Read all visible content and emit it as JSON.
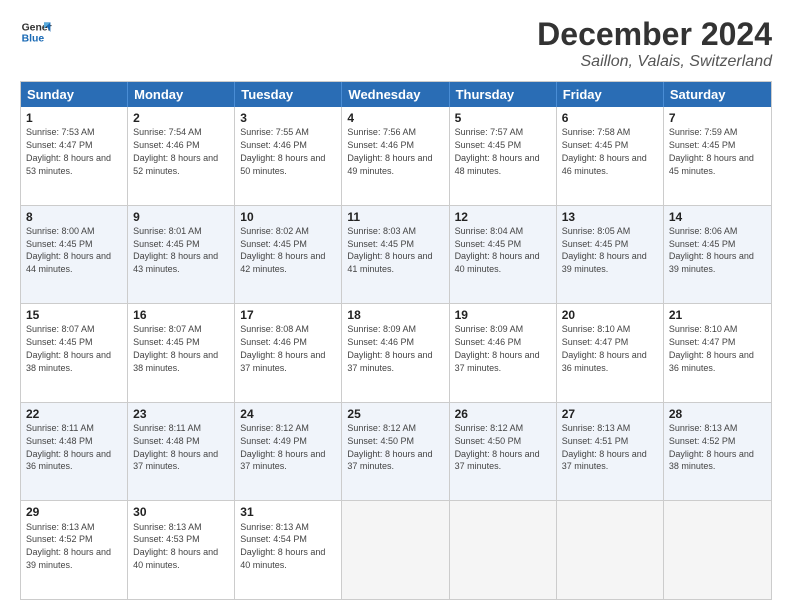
{
  "logo": {
    "line1": "General",
    "line2": "Blue"
  },
  "title": "December 2024",
  "subtitle": "Saillon, Valais, Switzerland",
  "headers": [
    "Sunday",
    "Monday",
    "Tuesday",
    "Wednesday",
    "Thursday",
    "Friday",
    "Saturday"
  ],
  "weeks": [
    [
      {
        "day": "1",
        "rise": "Sunrise: 7:53 AM",
        "set": "Sunset: 4:47 PM",
        "daylight": "Daylight: 8 hours and 53 minutes."
      },
      {
        "day": "2",
        "rise": "Sunrise: 7:54 AM",
        "set": "Sunset: 4:46 PM",
        "daylight": "Daylight: 8 hours and 52 minutes."
      },
      {
        "day": "3",
        "rise": "Sunrise: 7:55 AM",
        "set": "Sunset: 4:46 PM",
        "daylight": "Daylight: 8 hours and 50 minutes."
      },
      {
        "day": "4",
        "rise": "Sunrise: 7:56 AM",
        "set": "Sunset: 4:46 PM",
        "daylight": "Daylight: 8 hours and 49 minutes."
      },
      {
        "day": "5",
        "rise": "Sunrise: 7:57 AM",
        "set": "Sunset: 4:45 PM",
        "daylight": "Daylight: 8 hours and 48 minutes."
      },
      {
        "day": "6",
        "rise": "Sunrise: 7:58 AM",
        "set": "Sunset: 4:45 PM",
        "daylight": "Daylight: 8 hours and 46 minutes."
      },
      {
        "day": "7",
        "rise": "Sunrise: 7:59 AM",
        "set": "Sunset: 4:45 PM",
        "daylight": "Daylight: 8 hours and 45 minutes."
      }
    ],
    [
      {
        "day": "8",
        "rise": "Sunrise: 8:00 AM",
        "set": "Sunset: 4:45 PM",
        "daylight": "Daylight: 8 hours and 44 minutes."
      },
      {
        "day": "9",
        "rise": "Sunrise: 8:01 AM",
        "set": "Sunset: 4:45 PM",
        "daylight": "Daylight: 8 hours and 43 minutes."
      },
      {
        "day": "10",
        "rise": "Sunrise: 8:02 AM",
        "set": "Sunset: 4:45 PM",
        "daylight": "Daylight: 8 hours and 42 minutes."
      },
      {
        "day": "11",
        "rise": "Sunrise: 8:03 AM",
        "set": "Sunset: 4:45 PM",
        "daylight": "Daylight: 8 hours and 41 minutes."
      },
      {
        "day": "12",
        "rise": "Sunrise: 8:04 AM",
        "set": "Sunset: 4:45 PM",
        "daylight": "Daylight: 8 hours and 40 minutes."
      },
      {
        "day": "13",
        "rise": "Sunrise: 8:05 AM",
        "set": "Sunset: 4:45 PM",
        "daylight": "Daylight: 8 hours and 39 minutes."
      },
      {
        "day": "14",
        "rise": "Sunrise: 8:06 AM",
        "set": "Sunset: 4:45 PM",
        "daylight": "Daylight: 8 hours and 39 minutes."
      }
    ],
    [
      {
        "day": "15",
        "rise": "Sunrise: 8:07 AM",
        "set": "Sunset: 4:45 PM",
        "daylight": "Daylight: 8 hours and 38 minutes."
      },
      {
        "day": "16",
        "rise": "Sunrise: 8:07 AM",
        "set": "Sunset: 4:45 PM",
        "daylight": "Daylight: 8 hours and 38 minutes."
      },
      {
        "day": "17",
        "rise": "Sunrise: 8:08 AM",
        "set": "Sunset: 4:46 PM",
        "daylight": "Daylight: 8 hours and 37 minutes."
      },
      {
        "day": "18",
        "rise": "Sunrise: 8:09 AM",
        "set": "Sunset: 4:46 PM",
        "daylight": "Daylight: 8 hours and 37 minutes."
      },
      {
        "day": "19",
        "rise": "Sunrise: 8:09 AM",
        "set": "Sunset: 4:46 PM",
        "daylight": "Daylight: 8 hours and 37 minutes."
      },
      {
        "day": "20",
        "rise": "Sunrise: 8:10 AM",
        "set": "Sunset: 4:47 PM",
        "daylight": "Daylight: 8 hours and 36 minutes."
      },
      {
        "day": "21",
        "rise": "Sunrise: 8:10 AM",
        "set": "Sunset: 4:47 PM",
        "daylight": "Daylight: 8 hours and 36 minutes."
      }
    ],
    [
      {
        "day": "22",
        "rise": "Sunrise: 8:11 AM",
        "set": "Sunset: 4:48 PM",
        "daylight": "Daylight: 8 hours and 36 minutes."
      },
      {
        "day": "23",
        "rise": "Sunrise: 8:11 AM",
        "set": "Sunset: 4:48 PM",
        "daylight": "Daylight: 8 hours and 37 minutes."
      },
      {
        "day": "24",
        "rise": "Sunrise: 8:12 AM",
        "set": "Sunset: 4:49 PM",
        "daylight": "Daylight: 8 hours and 37 minutes."
      },
      {
        "day": "25",
        "rise": "Sunrise: 8:12 AM",
        "set": "Sunset: 4:50 PM",
        "daylight": "Daylight: 8 hours and 37 minutes."
      },
      {
        "day": "26",
        "rise": "Sunrise: 8:12 AM",
        "set": "Sunset: 4:50 PM",
        "daylight": "Daylight: 8 hours and 37 minutes."
      },
      {
        "day": "27",
        "rise": "Sunrise: 8:13 AM",
        "set": "Sunset: 4:51 PM",
        "daylight": "Daylight: 8 hours and 37 minutes."
      },
      {
        "day": "28",
        "rise": "Sunrise: 8:13 AM",
        "set": "Sunset: 4:52 PM",
        "daylight": "Daylight: 8 hours and 38 minutes."
      }
    ],
    [
      {
        "day": "29",
        "rise": "Sunrise: 8:13 AM",
        "set": "Sunset: 4:52 PM",
        "daylight": "Daylight: 8 hours and 39 minutes."
      },
      {
        "day": "30",
        "rise": "Sunrise: 8:13 AM",
        "set": "Sunset: 4:53 PM",
        "daylight": "Daylight: 8 hours and 40 minutes."
      },
      {
        "day": "31",
        "rise": "Sunrise: 8:13 AM",
        "set": "Sunset: 4:54 PM",
        "daylight": "Daylight: 8 hours and 40 minutes."
      },
      null,
      null,
      null,
      null
    ]
  ]
}
